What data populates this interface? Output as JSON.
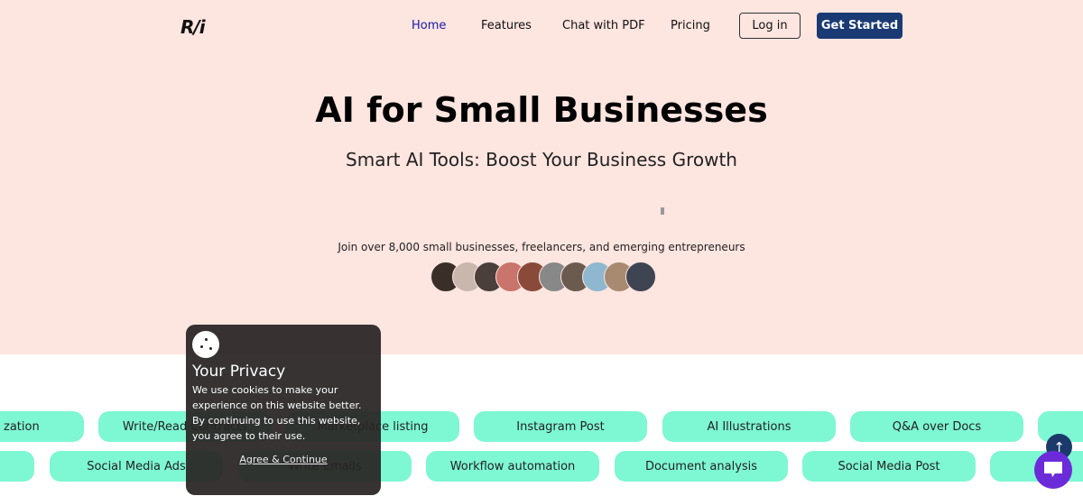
{
  "header": {
    "logo": "R/i",
    "nav": [
      "Home",
      "Features",
      "Chat with PDF",
      "Pricing"
    ],
    "login": "Log in",
    "get_started": "Get Started",
    "active_color": "#1a1aa8"
  },
  "hero": {
    "title": "AI for Small Businesses",
    "subtitle": "Smart AI Tools: Boost Your Business Growth",
    "join_text": "Join over 8,000 small businesses, freelancers, and emerging entrepreneurs"
  },
  "avatars": [
    "#3a2e28",
    "#c9b7ae",
    "#4a3f3a",
    "#c9756b",
    "#8a4a3a",
    "#888888",
    "#6b5a4e",
    "#8fb7d0",
    "#a88a70",
    "#3e4452"
  ],
  "features": {
    "row1": [
      "zation",
      "Write/Read Contracts",
      "Marketplace listing",
      "Instagram Post",
      "AI Illustrations",
      "Q&A over Docs",
      ""
    ],
    "row2": [
      "",
      "Social Media Ads",
      "Write Emails",
      "Workflow automation",
      "Document analysis",
      "Social Media Post",
      ""
    ]
  },
  "cookie": {
    "title": "Your Privacy",
    "text": "We use cookies to make your experience on this website better. By continuing to use this website, you agree to their use.",
    "agree": "Agree & Continue"
  },
  "fab": {
    "up": "↑"
  }
}
